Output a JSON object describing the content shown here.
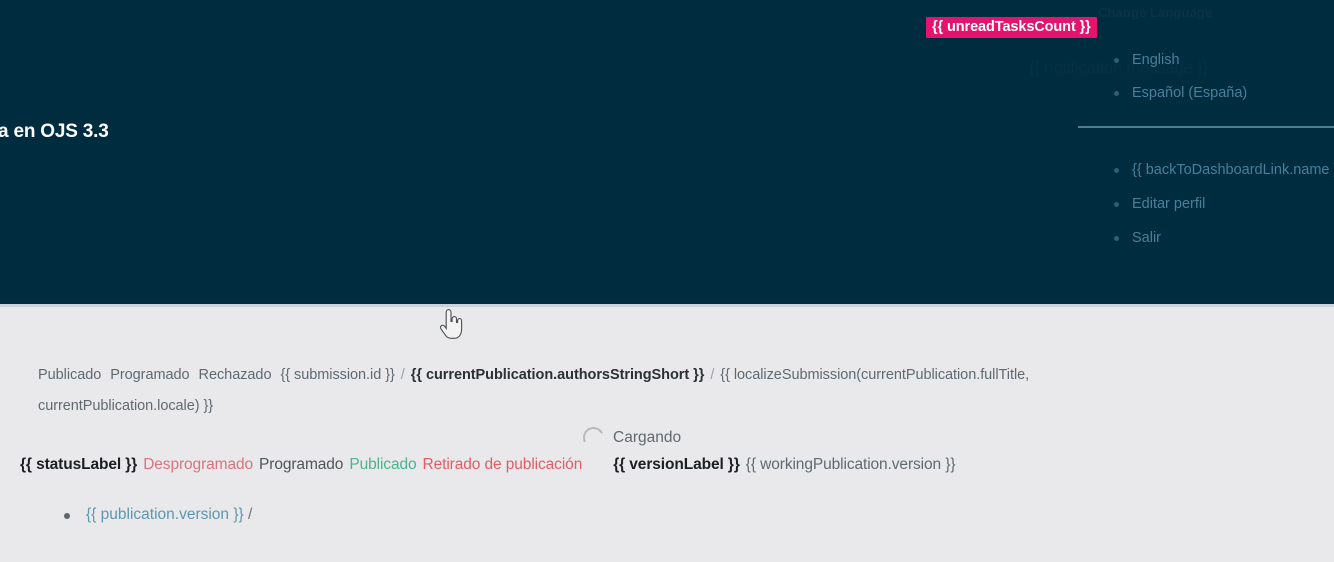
{
  "header": {
    "page_title": "a en OJS 3.3",
    "unread_tasks_badge": "{{ unreadTasksCount }}",
    "change_language_heading": "Change Language",
    "notification_message": "{{ notification.message }}",
    "languages": [
      {
        "label": "English"
      },
      {
        "label": "Español (España)"
      }
    ],
    "account_links": [
      {
        "label": "{{ backToDashboardLink.name }}"
      },
      {
        "label": "Editar perfil"
      },
      {
        "label": "Salir"
      }
    ]
  },
  "breadcrumb": {
    "status_published": "Publicado",
    "status_scheduled": "Programado",
    "status_declined": "Rechazado",
    "submission_id": "{{ submission.id }}",
    "separator": "/",
    "authors": "{{ currentPublication.authorsStringShort }}",
    "full_title_line1": "{{ localizeSubmission(currentPublication.fullTitle,",
    "full_title_line2": "currentPublication.locale) }}"
  },
  "loading": {
    "label": "Cargando",
    "spinner_icon": "spinner-icon"
  },
  "status_row": {
    "status_label": "{{ statusLabel }}",
    "unscheduled": "Desprogramado",
    "scheduled": "Programado",
    "published": "Publicado",
    "unpublished": "Retirado de publicación",
    "version_label": "{{ versionLabel }}",
    "working_version": "{{ workingPublication.version }}"
  },
  "publication_versions": [
    {
      "label": "{{ publication.version }}",
      "separator": "/"
    }
  ],
  "colors": {
    "header_bg": "#002c40",
    "body_bg": "#e9e9eb",
    "badge_pink": "#e3136e",
    "link_blue": "#4a7f9a",
    "published_green": "#49b38a",
    "unpublished_red": "#e25c62",
    "unscheduled_red": "#d9737e"
  },
  "cursor": {
    "icon": "pointing-hand-cursor"
  }
}
